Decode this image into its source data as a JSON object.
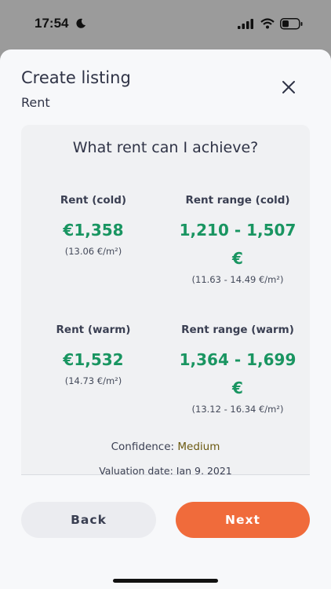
{
  "status_bar": {
    "time": "17:54"
  },
  "header": {
    "title": "Create listing",
    "subtitle": "Rent"
  },
  "card": {
    "heading": "What rent can I achieve?",
    "metrics": [
      {
        "label": "Rent (cold)",
        "value": "€1,358",
        "unit": "(13.06 €/m²)"
      },
      {
        "label": "Rent range (cold)",
        "value_line1": "1,210 - 1,507",
        "value_line2": "€",
        "unit": "(11.63 - 14.49 €/m²)"
      },
      {
        "label": "Rent (warm)",
        "value": "€1,532",
        "unit": "(14.73 €/m²)"
      },
      {
        "label": "Rent range (warm)",
        "value_line1": "1,364 - 1,699",
        "value_line2": "€",
        "unit": "(13.12 - 16.34 €/m²)"
      }
    ],
    "confidence_label": "Confidence:",
    "confidence_value": "Medium",
    "valuation_date": "Valuation date: Jan 9, 2021"
  },
  "footer": {
    "back_label": "Back",
    "next_label": "Next"
  },
  "colors": {
    "accent_green": "#199561",
    "button_orange": "#f06b3b",
    "confidence": "#6b5a12"
  }
}
